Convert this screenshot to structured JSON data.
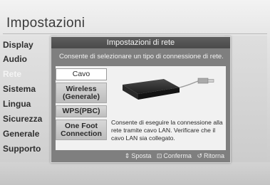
{
  "screen": {
    "title": "Impostazioni",
    "sidebar": [
      {
        "label": "Display",
        "dim": false
      },
      {
        "label": "Audio",
        "dim": false
      },
      {
        "label": "Rete",
        "dim": true
      },
      {
        "label": "Sistema",
        "dim": false
      },
      {
        "label": "Lingua",
        "dim": false
      },
      {
        "label": "Sicurezza",
        "dim": false
      },
      {
        "label": "Generale",
        "dim": false
      },
      {
        "label": "Supporto",
        "dim": false
      }
    ]
  },
  "dialog": {
    "title": "Impostazioni di rete",
    "description": "Consente di selezionare un tipo di connessione di rete.",
    "options": [
      {
        "label": "Cavo",
        "selected": true
      },
      {
        "label": "Wireless (Generale)",
        "selected": false
      },
      {
        "label": "WPS(PBC)",
        "selected": false
      },
      {
        "label": "One Foot Connection",
        "selected": false
      }
    ],
    "info": "Consente di eseguire la connessione alla rete tramite cavo LAN. Verificare che il cavo LAN sia collegato.",
    "footer": {
      "move": "Sposta",
      "confirm": "Conferma",
      "back": "Ritorna"
    }
  }
}
